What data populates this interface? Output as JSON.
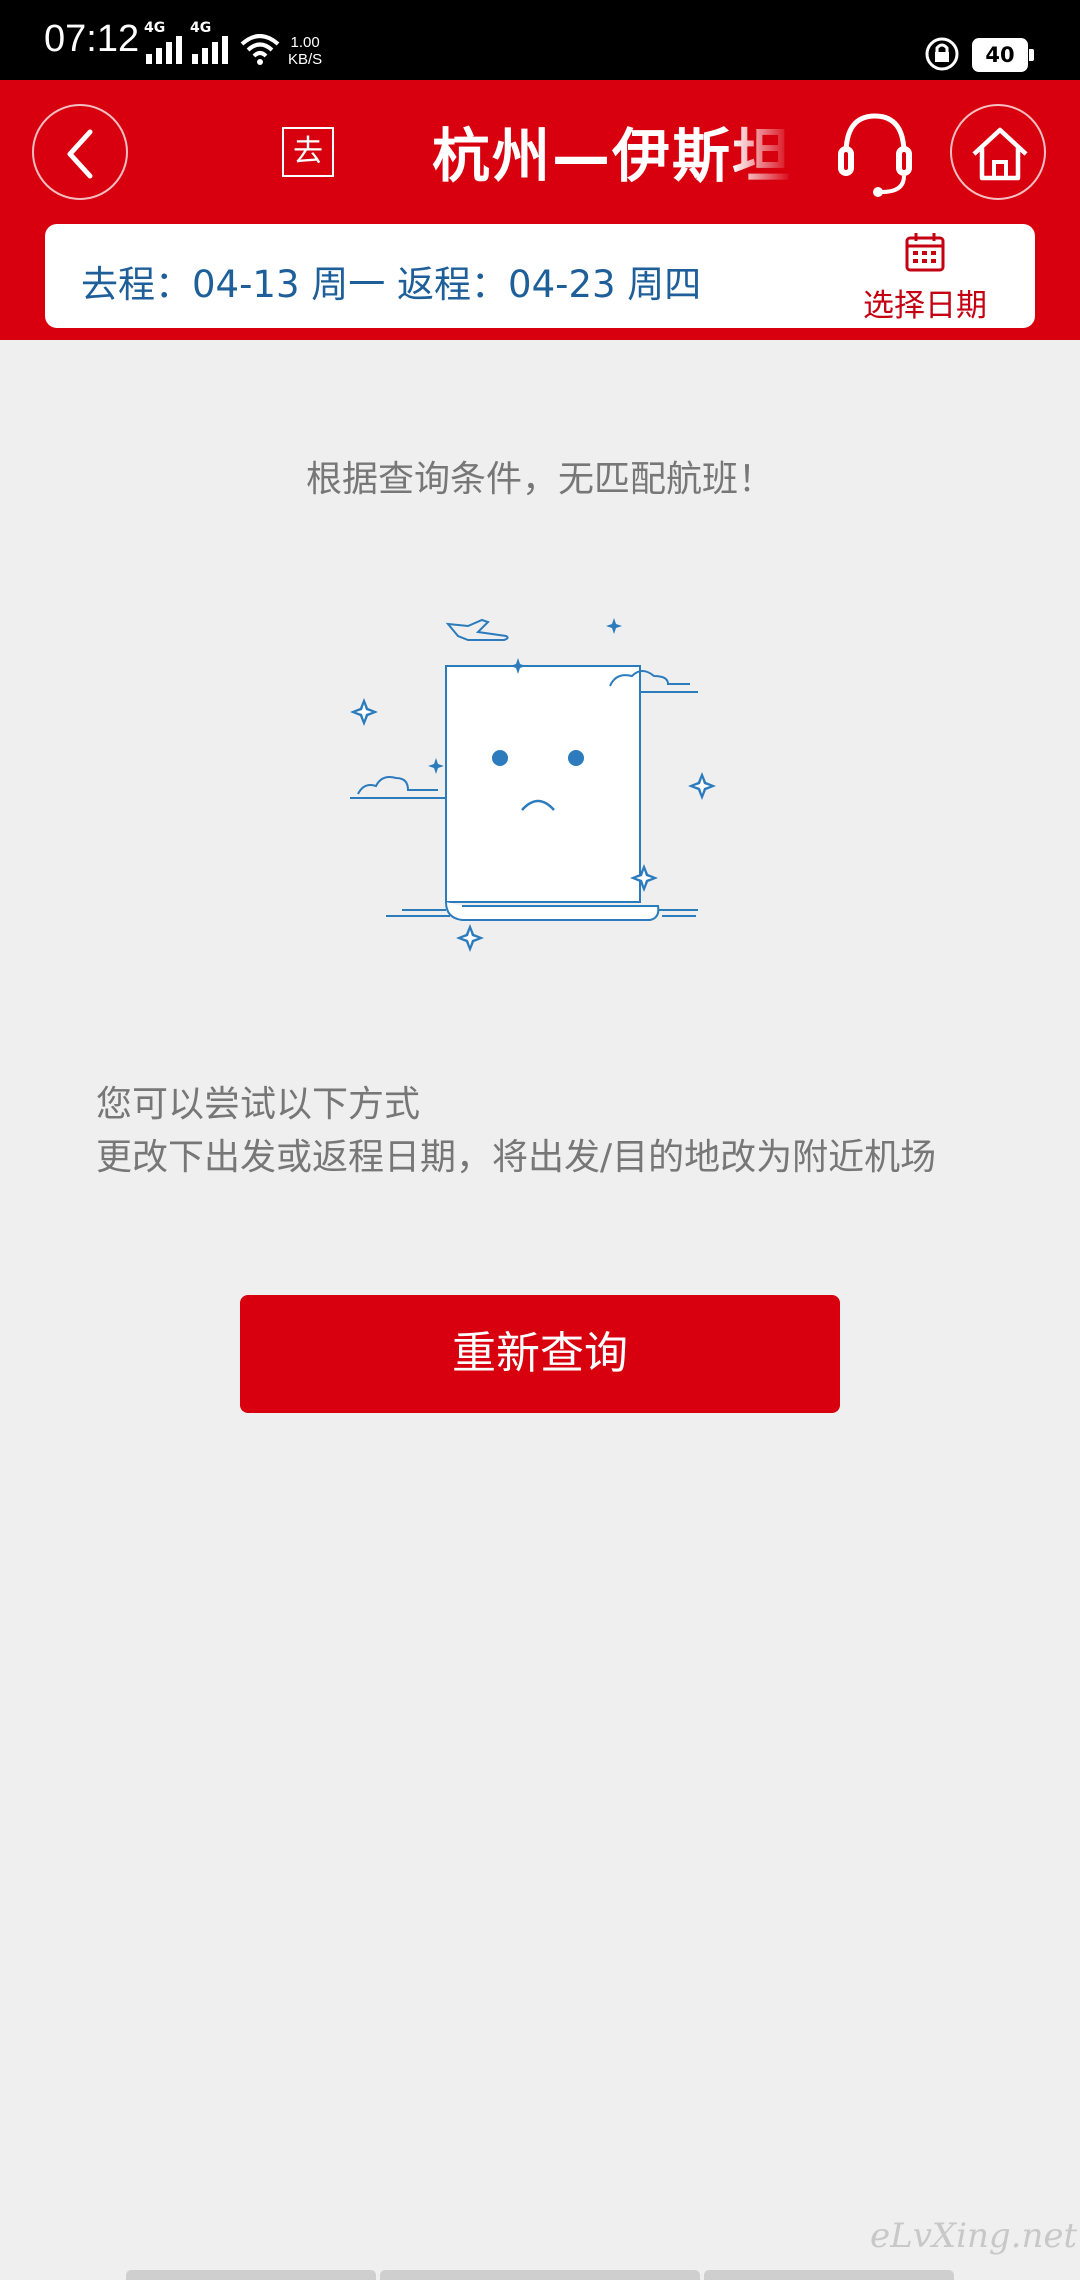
{
  "status_bar": {
    "time": "07:12",
    "net_speed_value": "1.00",
    "net_speed_unit": "KB/S",
    "sim1": "4G",
    "sim2": "4G",
    "battery": "40"
  },
  "header": {
    "trip_tag": "去",
    "title": "杭州—伊斯坦布尔",
    "icons": [
      "back-arrow-icon",
      "headset-icon",
      "home-icon"
    ]
  },
  "dates": {
    "summary": "去程：04-13 周一 返程：04-23 周四",
    "select_label": "选择日期"
  },
  "main": {
    "notice": "根据查询条件，无匹配航班！",
    "tips_title": "您可以尝试以下方式",
    "tips_text": "更改下出发或返程日期，将出发/目的地改为附近机场",
    "retry_label": "重新查询"
  },
  "watermark": "eLvXing.net",
  "colors": {
    "brand_red": "#d8000f",
    "date_blue": "#1e5f9a",
    "illustration_blue": "#2b7bbd"
  }
}
